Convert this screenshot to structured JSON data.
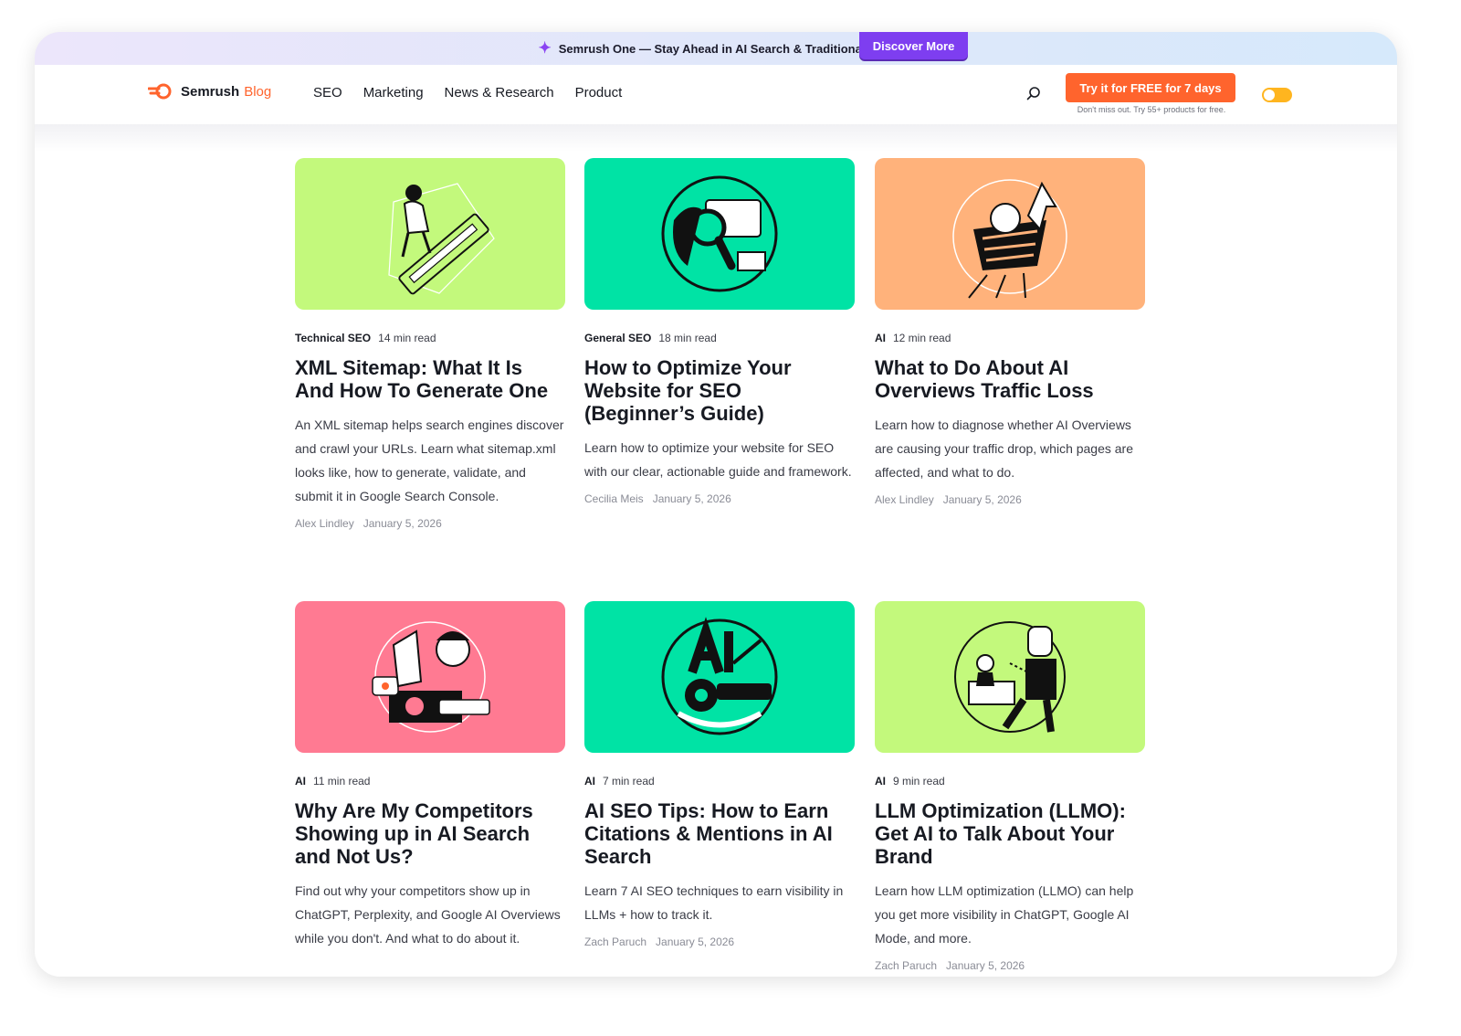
{
  "promo": {
    "text": "Semrush One — Stay Ahead in AI Search & Traditional SEO",
    "cta": "Discover More"
  },
  "header": {
    "brand": "Semrush",
    "brand_suffix": "Blog",
    "menu": [
      "SEO",
      "Marketing",
      "News & Research",
      "Product"
    ],
    "cta": "Try it for FREE for 7 days",
    "cta_sub": "Don't miss out. Try 55+ products for free."
  },
  "colors": {
    "accent": "#ff642d",
    "purple": "#7e3ef0",
    "lime": "#c3f97c",
    "teal": "#00e3a5",
    "orange": "#ffb27b",
    "pink": "#ff7a92"
  },
  "articles": [
    {
      "category": "Technical SEO",
      "read": "14 min read",
      "title": "XML Sitemap: What It Is And How To Generate One",
      "desc": "An XML sitemap helps search engines discover and crawl your URLs. Learn what sitemap.xml looks like, how to generate, validate, and submit it in Google Search Console.",
      "author": "Alex Lindley",
      "date": "January 5, 2026",
      "image_color": "#c3f97c",
      "icon": "sitemap-illustration-icon"
    },
    {
      "category": "General SEO",
      "read": "18 min read",
      "title": "How to Optimize Your Website for SEO (Beginner’s Guide)",
      "desc": "Learn how to optimize your website for SEO with our clear, actionable guide and framework.",
      "author": "Cecilia Meis",
      "date": "January 5, 2026",
      "image_color": "#00e3a5",
      "icon": "magnifier-illustration-icon"
    },
    {
      "category": "AI",
      "read": "12 min read",
      "title": "What to Do About AI Overviews Traffic Loss",
      "desc": "Learn how to diagnose whether AI Overviews are causing your traffic drop, which pages are affected, and what to do.",
      "author": "Alex Lindley",
      "date": "January 5, 2026",
      "image_color": "#ffb27b",
      "icon": "basket-illustration-icon"
    },
    {
      "category": "AI",
      "read": "11 min read",
      "title": "Why Are My Competitors Showing up in AI Search and Not Us?",
      "desc": "Find out why your competitors show up in ChatGPT, Perplexity, and Google AI Overviews while you don't. And what to do about it.",
      "author": "",
      "date": "",
      "image_color": "#ff7a92",
      "icon": "competitor-illustration-icon"
    },
    {
      "category": "AI",
      "read": "7 min read",
      "title": "AI SEO Tips: How to Earn Citations & Mentions in AI Search",
      "desc": "Learn 7 AI SEO techniques to earn visibility in LLMs + how to track it.",
      "author": "Zach Paruch",
      "date": "January 5, 2026",
      "image_color": "#00e3a5",
      "icon": "ai-rating-illustration-icon"
    },
    {
      "category": "AI",
      "read": "9 min read",
      "title": "LLM Optimization (LLMO): Get AI to Talk About Your Brand",
      "desc": "Learn how LLM optimization (LLMO) can help you get more visibility in ChatGPT, Google AI Mode, and more.",
      "author": "Zach Paruch",
      "date": "January 5, 2026",
      "image_color": "#c3f97c",
      "icon": "robot-illustration-icon"
    }
  ]
}
